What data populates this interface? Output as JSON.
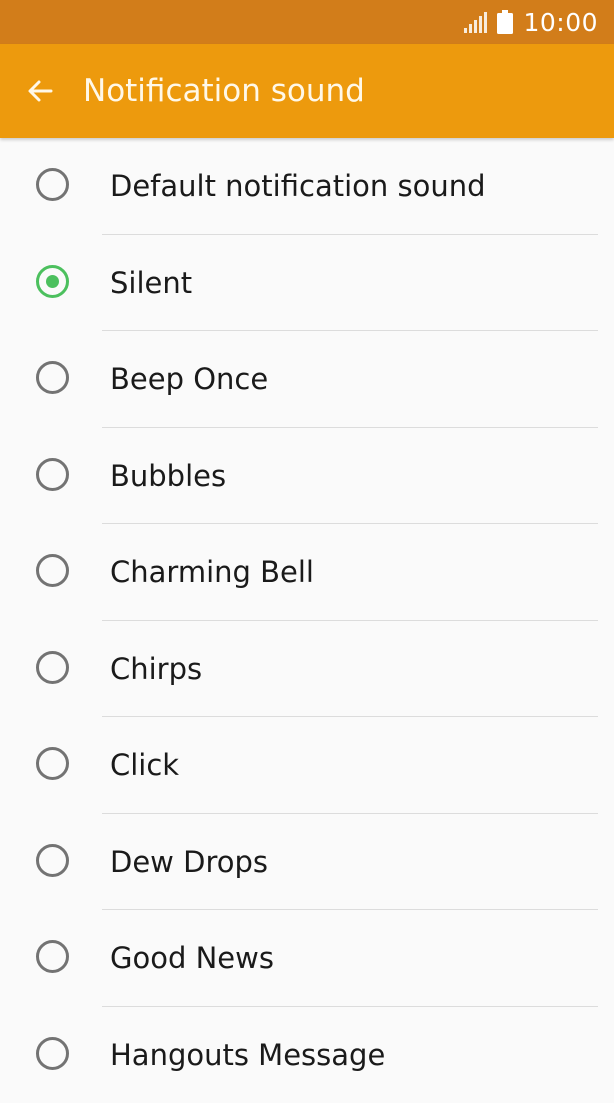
{
  "status_bar": {
    "time": "10:00",
    "signal_icon": "signal-icon",
    "battery_icon": "battery-icon"
  },
  "app_bar": {
    "title": "Notification sound",
    "back_icon": "back-arrow-icon"
  },
  "colors": {
    "status_bar": "#d27d1a",
    "app_bar": "#ed9a0d",
    "accent": "#4cc05e",
    "background": "#fafafa"
  },
  "sounds": {
    "selected": "Silent",
    "items": [
      {
        "label": "Default notification sound",
        "checked": false
      },
      {
        "label": "Silent",
        "checked": true
      },
      {
        "label": "Beep Once",
        "checked": false
      },
      {
        "label": "Bubbles",
        "checked": false
      },
      {
        "label": "Charming Bell",
        "checked": false
      },
      {
        "label": "Chirps",
        "checked": false
      },
      {
        "label": "Click",
        "checked": false
      },
      {
        "label": "Dew Drops",
        "checked": false
      },
      {
        "label": "Good News",
        "checked": false
      },
      {
        "label": "Hangouts Message",
        "checked": false
      }
    ]
  }
}
